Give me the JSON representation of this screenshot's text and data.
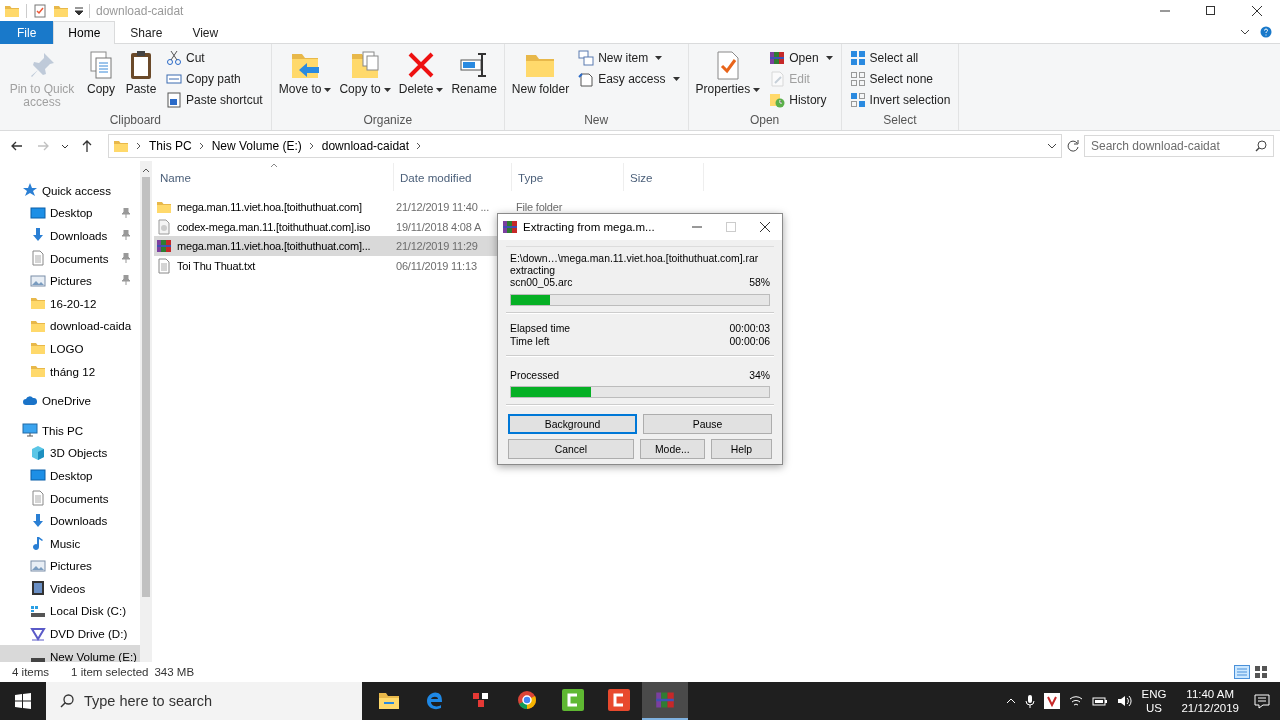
{
  "title_bar": {
    "title": "download-caidat"
  },
  "ribbon": {
    "tabs": [
      {
        "label": "File",
        "kind": "file",
        "selected": false
      },
      {
        "label": "Home",
        "kind": "tab",
        "selected": true
      },
      {
        "label": "Share",
        "kind": "tab",
        "selected": false
      },
      {
        "label": "View",
        "kind": "tab",
        "selected": false
      }
    ],
    "groups": [
      {
        "label": "Clipboard",
        "large": [
          {
            "label": "Pin to Quick access",
            "disabled": true,
            "dropdown": false
          },
          {
            "label": "Copy",
            "disabled": false,
            "dropdown": false
          },
          {
            "label": "Paste",
            "disabled": false,
            "dropdown": false
          }
        ],
        "small": [
          {
            "label": "Cut",
            "disabled": false,
            "dropdown": false
          },
          {
            "label": "Copy path",
            "disabled": false,
            "dropdown": false
          },
          {
            "label": "Paste shortcut",
            "disabled": false,
            "dropdown": false
          }
        ]
      },
      {
        "label": "Organize",
        "large": [
          {
            "label": "Move to",
            "disabled": false,
            "dropdown": true
          },
          {
            "label": "Copy to",
            "disabled": false,
            "dropdown": true
          },
          {
            "label": "Delete",
            "disabled": false,
            "dropdown": true
          },
          {
            "label": "Rename",
            "disabled": false,
            "dropdown": false
          }
        ]
      },
      {
        "label": "New",
        "large": [
          {
            "label": "New folder",
            "disabled": false,
            "dropdown": false
          }
        ],
        "small": [
          {
            "label": "New item",
            "disabled": false,
            "dropdown": true
          },
          {
            "label": "Easy access",
            "disabled": false,
            "dropdown": true
          }
        ]
      },
      {
        "label": "Open",
        "large": [
          {
            "label": "Properties",
            "disabled": false,
            "dropdown": true
          }
        ],
        "small": [
          {
            "label": "Open",
            "disabled": false,
            "dropdown": true
          },
          {
            "label": "Edit",
            "disabled": true,
            "dropdown": false
          },
          {
            "label": "History",
            "disabled": false,
            "dropdown": false
          }
        ]
      },
      {
        "label": "Select",
        "small": [
          {
            "label": "Select all",
            "disabled": false,
            "dropdown": false
          },
          {
            "label": "Select none",
            "disabled": false,
            "dropdown": false
          },
          {
            "label": "Invert selection",
            "disabled": false,
            "dropdown": false
          }
        ]
      }
    ]
  },
  "address_bar": {
    "nav_buttons": [
      {
        "kind": "back",
        "disabled": false
      },
      {
        "kind": "forward",
        "disabled": true
      },
      {
        "kind": "recent",
        "disabled": false
      },
      {
        "kind": "up",
        "disabled": false
      }
    ],
    "breadcrumb": [
      "This PC",
      "New Volume (E:)",
      "download-caidat"
    ],
    "search": {
      "placeholder": "Search download-caidat"
    }
  },
  "sidebar": {
    "items": [
      {
        "label": "Quick access",
        "kind": "star",
        "selected": false,
        "pinned": false,
        "children": [
          {
            "label": "Desktop",
            "kind": "desktop",
            "selected": false,
            "pinned": true
          },
          {
            "label": "Downloads",
            "kind": "downloads",
            "selected": false,
            "pinned": true
          },
          {
            "label": "Documents",
            "kind": "documents",
            "selected": false,
            "pinned": true
          },
          {
            "label": "Pictures",
            "kind": "pictures",
            "selected": false,
            "pinned": true
          },
          {
            "label": "16-20-12",
            "kind": "folder",
            "selected": false,
            "pinned": false
          },
          {
            "label": "download-caida",
            "kind": "folder",
            "selected": false,
            "pinned": false
          },
          {
            "label": "LOGO",
            "kind": "folder",
            "selected": false,
            "pinned": false
          },
          {
            "label": "tháng 12",
            "kind": "folder",
            "selected": false,
            "pinned": false
          }
        ]
      },
      {
        "label": "OneDrive",
        "kind": "cloud",
        "selected": false,
        "pinned": false
      },
      {
        "label": "This PC",
        "kind": "pc",
        "selected": false,
        "pinned": false,
        "children": [
          {
            "label": "3D Objects",
            "kind": "cube",
            "selected": false,
            "pinned": false
          },
          {
            "label": "Desktop",
            "kind": "desktop",
            "selected": false,
            "pinned": false
          },
          {
            "label": "Documents",
            "kind": "documents",
            "selected": false,
            "pinned": false
          },
          {
            "label": "Downloads",
            "kind": "downloads",
            "selected": false,
            "pinned": false
          },
          {
            "label": "Music",
            "kind": "music",
            "selected": false,
            "pinned": false
          },
          {
            "label": "Pictures",
            "kind": "pictures",
            "selected": false,
            "pinned": false
          },
          {
            "label": "Videos",
            "kind": "videos",
            "selected": false,
            "pinned": false
          },
          {
            "label": "Local Disk (C:)",
            "kind": "disk",
            "selected": false,
            "pinned": false
          },
          {
            "label": "DVD Drive (D:)",
            "kind": "dvd",
            "selected": false,
            "pinned": false
          },
          {
            "label": "New Volume (E:)",
            "kind": "drive",
            "selected": true,
            "pinned": false
          }
        ]
      }
    ]
  },
  "file_list": {
    "columns": [
      "Name",
      "Date modified",
      "Type",
      "Size"
    ],
    "rows": [
      {
        "kind": "folder",
        "name": "mega.man.11.viet.hoa.[toithuthuat.com]",
        "date": "21/12/2019 11:40 ...",
        "type": "File folder",
        "selected": false
      },
      {
        "kind": "disc",
        "name": "codex-mega.man.11.[toithuthuat.com].iso",
        "date": "19/11/2018 4:08 A",
        "selected": false
      },
      {
        "kind": "archive",
        "name": "mega.man.11.viet.hoa.[toithuthuat.com]...",
        "date": "21/12/2019 11:29",
        "selected": true
      },
      {
        "kind": "text",
        "name": "Toi Thu Thuat.txt",
        "date": "06/11/2019 11:13",
        "selected": false
      }
    ]
  },
  "status_bar": {
    "count": "4 items",
    "selection": "1 item selected",
    "size": "343 MB"
  },
  "dialog": {
    "title": "Extracting from mega.m...",
    "path": "E:\\down…\\mega.man.11.viet.hoa.[toithuthuat.com].rar",
    "action": "extracting",
    "file_progress": {
      "file": "scn00_05.arc",
      "percent": "58%",
      "level": 0.15
    },
    "times": [
      {
        "label": "Elapsed time",
        "value": "00:00:03"
      },
      {
        "label": "Time left",
        "value": "00:00:06"
      }
    ],
    "total_progress": {
      "label": "Processed",
      "percent": "34%",
      "level": 0.31
    },
    "buttons": [
      [
        {
          "label": "Background",
          "focused": true
        },
        {
          "label": "Pause",
          "focused": false
        }
      ],
      [
        {
          "label": "Cancel",
          "focused": false
        },
        {
          "label": "Mode...",
          "focused": false
        },
        {
          "label": "Help",
          "focused": false
        }
      ]
    ]
  },
  "taskbar": {
    "search": {
      "placeholder": "Type here to search"
    },
    "apps": [
      {
        "kind": "explorer",
        "active": false
      },
      {
        "kind": "edge",
        "active": false
      },
      {
        "kind": "app",
        "active": false
      },
      {
        "kind": "chrome",
        "active": false
      },
      {
        "kind": "green-c",
        "active": false
      },
      {
        "kind": "red-c",
        "active": false
      },
      {
        "kind": "archive",
        "active": true
      }
    ],
    "tray": {
      "language": "ENG",
      "region": "US",
      "time": "11:40 AM",
      "date": "21/12/2019"
    }
  }
}
